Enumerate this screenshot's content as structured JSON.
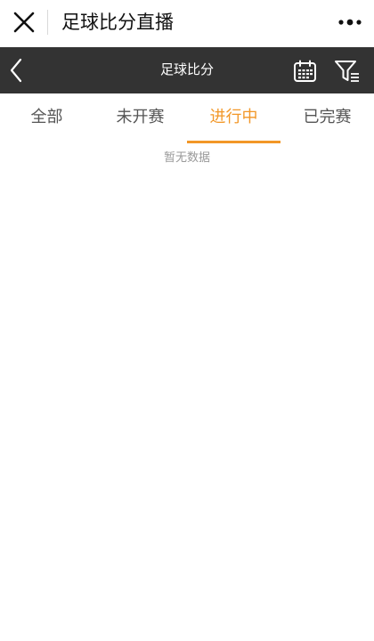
{
  "window": {
    "title": "足球比分直播",
    "close_icon": "close-icon",
    "more_icon": "more-dots-icon"
  },
  "navbar": {
    "title": "足球比分",
    "back_icon": "chevron-left-icon",
    "calendar_icon": "calendar-icon",
    "filter_icon": "filter-icon",
    "background": "#333333"
  },
  "tabs": [
    {
      "label": "全部",
      "active": false
    },
    {
      "label": "未开赛",
      "active": false
    },
    {
      "label": "进行中",
      "active": true
    },
    {
      "label": "已完赛",
      "active": false
    }
  ],
  "content": {
    "empty_text": "暂无数据"
  },
  "colors": {
    "accent": "#f29727"
  }
}
